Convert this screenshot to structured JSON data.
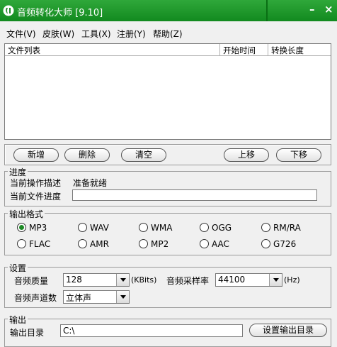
{
  "window": {
    "title": "音频转化大师 [9.10]",
    "minimize": "–",
    "close": "×"
  },
  "menu": [
    "文件(V)",
    "皮肤(W)",
    "工具(X)",
    "注册(Y)",
    "帮助(Z)"
  ],
  "list": {
    "columns": [
      "文件列表",
      "开始时间",
      "转换长度"
    ]
  },
  "buttons": {
    "add": "新增",
    "delete": "删除",
    "clear": "清空",
    "up": "上移",
    "down": "下移"
  },
  "progress": {
    "legend": "进度",
    "desc_label": "当前操作描述",
    "desc_value": "准备就绪",
    "file_label": "当前文件进度"
  },
  "format": {
    "legend": "输出格式",
    "options": [
      "MP3",
      "WAV",
      "WMA",
      "OGG",
      "RM/RA",
      "FLAC",
      "AMR",
      "MP2",
      "AAC",
      "G726"
    ],
    "selected": "MP3"
  },
  "settings": {
    "legend": "设置",
    "quality_label": "音频质量",
    "quality_value": "128",
    "quality_unit": "(KBits)",
    "rate_label": "音频采样率",
    "rate_value": "44100",
    "rate_unit": "(Hz)",
    "channel_label": "音频声道数",
    "channel_value": "立体声"
  },
  "output": {
    "legend": "输出",
    "dir_label": "输出目录",
    "dir_value": "C:\\",
    "dir_button": "设置输出目录"
  },
  "colors": {
    "titlebar": "#1a9a28",
    "radio_selected": "#1e8a26"
  }
}
